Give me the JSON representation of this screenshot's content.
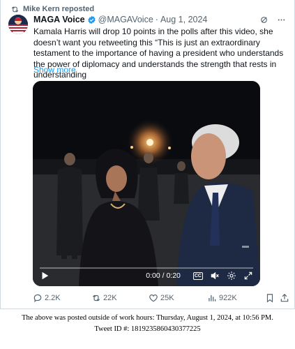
{
  "repost": {
    "text": "Mike Kern reposted"
  },
  "author": {
    "display_name": "MAGA Voice",
    "handle": "@MAGAVoice",
    "separator": "·",
    "date": "Aug 1, 2024"
  },
  "tweet": {
    "text": "Kamala Harris will drop 10 points in the polls after this video, she doesn’t want you retweeting this “This is just an extraordinary testament to the importance of having a president who understands the power of diplomacy and understands the strength that rests in understanding",
    "show_more": "Show more"
  },
  "video": {
    "time": "0:00 / 0:20",
    "progress": 0,
    "cc_label": "CC"
  },
  "actions": {
    "replies": "2.2K",
    "reposts": "22K",
    "likes": "25K",
    "views": "922K"
  },
  "footer": {
    "line1": "The above was posted outside of work hours: Thursday, August 1, 2024, at 10:56 PM.",
    "line2": "Tweet ID #: 1819235860430377225"
  },
  "colors": {
    "accent": "#1d9bf0",
    "muted": "#536471",
    "text": "#0f1419"
  }
}
